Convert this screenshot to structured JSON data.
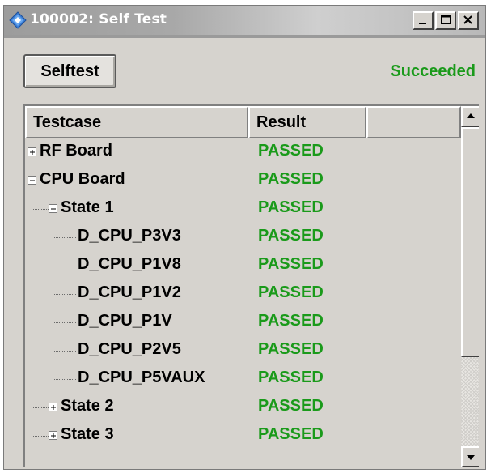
{
  "window": {
    "title": "100002: Self Test",
    "minimize_label": "_",
    "maximize_label": "□",
    "close_label": "X"
  },
  "toolbar": {
    "selftest_label": "Selftest",
    "status": "Succeeded"
  },
  "colors": {
    "passed": "#1a9a1a",
    "window_bg": "#d6d3ce",
    "title_text": "#ffffff"
  },
  "table": {
    "columns": [
      "Testcase",
      "Result",
      ""
    ],
    "rows": [
      {
        "label": "RF Board",
        "result": "PASSED",
        "depth": 0,
        "expander": "plus"
      },
      {
        "label": "CPU Board",
        "result": "PASSED",
        "depth": 0,
        "expander": "minus"
      },
      {
        "label": "State 1",
        "result": "PASSED",
        "depth": 1,
        "expander": "minus"
      },
      {
        "label": "D_CPU_P3V3",
        "result": "PASSED",
        "depth": 2,
        "expander": "none"
      },
      {
        "label": "D_CPU_P1V8",
        "result": "PASSED",
        "depth": 2,
        "expander": "none"
      },
      {
        "label": "D_CPU_P1V2",
        "result": "PASSED",
        "depth": 2,
        "expander": "none"
      },
      {
        "label": "D_CPU_P1V",
        "result": "PASSED",
        "depth": 2,
        "expander": "none"
      },
      {
        "label": "D_CPU_P2V5",
        "result": "PASSED",
        "depth": 2,
        "expander": "none"
      },
      {
        "label": "D_CPU_P5VAUX",
        "result": "PASSED",
        "depth": 2,
        "expander": "none"
      },
      {
        "label": "State 2",
        "result": "PASSED",
        "depth": 1,
        "expander": "plus"
      },
      {
        "label": "State 3",
        "result": "PASSED",
        "depth": 1,
        "expander": "plus"
      }
    ]
  },
  "scrollbar": {
    "position_fraction": 0.0,
    "visible_fraction": 0.72
  }
}
